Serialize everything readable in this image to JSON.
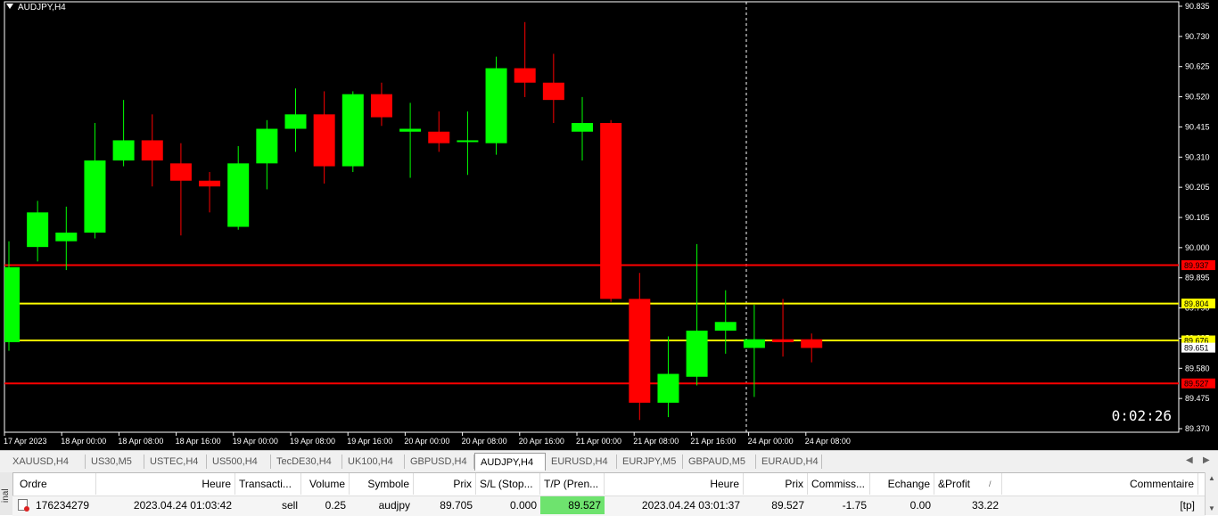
{
  "chart": {
    "title": "AUDJPY,H4",
    "timer": "0:02:26",
    "colors": {
      "bull": "#00ff00",
      "bear": "#ff0000",
      "background": "#000000",
      "grid_text": "#ffffff",
      "sl_line": "#ff0000",
      "tp_line": "#ffff00"
    }
  },
  "chart_data": {
    "type": "candlestick",
    "symbol": "AUDJPY",
    "timeframe": "H4",
    "ylim": [
      89.37,
      90.835
    ],
    "y_ticks": [
      "90.835",
      "90.730",
      "90.625",
      "90.520",
      "90.415",
      "90.310",
      "90.205",
      "90.105",
      "90.000",
      "89.895",
      "89.790",
      "89.685",
      "89.580",
      "89.475",
      "89.370"
    ],
    "x_ticks": [
      "17 Apr 2023",
      "18 Apr 00:00",
      "18 Apr 08:00",
      "18 Apr 16:00",
      "19 Apr 00:00",
      "19 Apr 08:00",
      "19 Apr 16:00",
      "20 Apr 00:00",
      "20 Apr 08:00",
      "20 Apr 16:00",
      "21 Apr 00:00",
      "21 Apr 08:00",
      "21 Apr 16:00",
      "24 Apr 00:00",
      "24 Apr 08:00"
    ],
    "candles": [
      {
        "o": 89.67,
        "h": 90.02,
        "l": 89.64,
        "c": 89.93
      },
      {
        "o": 90.0,
        "h": 90.16,
        "l": 89.95,
        "c": 90.12
      },
      {
        "o": 90.02,
        "h": 90.14,
        "l": 89.92,
        "c": 90.05
      },
      {
        "o": 90.05,
        "h": 90.43,
        "l": 90.03,
        "c": 90.3
      },
      {
        "o": 90.3,
        "h": 90.51,
        "l": 90.28,
        "c": 90.37
      },
      {
        "o": 90.37,
        "h": 90.46,
        "l": 90.21,
        "c": 90.3
      },
      {
        "o": 90.29,
        "h": 90.36,
        "l": 90.04,
        "c": 90.23
      },
      {
        "o": 90.23,
        "h": 90.26,
        "l": 90.12,
        "c": 90.21
      },
      {
        "o": 90.07,
        "h": 90.35,
        "l": 90.06,
        "c": 90.29
      },
      {
        "o": 90.29,
        "h": 90.44,
        "l": 90.2,
        "c": 90.41
      },
      {
        "o": 90.41,
        "h": 90.55,
        "l": 90.33,
        "c": 90.46
      },
      {
        "o": 90.46,
        "h": 90.54,
        "l": 90.22,
        "c": 90.28
      },
      {
        "o": 90.28,
        "h": 90.54,
        "l": 90.26,
        "c": 90.53
      },
      {
        "o": 90.53,
        "h": 90.57,
        "l": 90.42,
        "c": 90.45
      },
      {
        "o": 90.4,
        "h": 90.5,
        "l": 90.24,
        "c": 90.41
      },
      {
        "o": 90.4,
        "h": 90.47,
        "l": 90.33,
        "c": 90.36
      },
      {
        "o": 90.37,
        "h": 90.47,
        "l": 90.25,
        "c": 90.37
      },
      {
        "o": 90.36,
        "h": 90.66,
        "l": 90.32,
        "c": 90.62
      },
      {
        "o": 90.62,
        "h": 90.78,
        "l": 90.52,
        "c": 90.57
      },
      {
        "o": 90.57,
        "h": 90.67,
        "l": 90.43,
        "c": 90.51
      },
      {
        "o": 90.4,
        "h": 90.52,
        "l": 90.3,
        "c": 90.43
      },
      {
        "o": 90.43,
        "h": 90.44,
        "l": 89.81,
        "c": 89.82
      },
      {
        "o": 89.82,
        "h": 89.91,
        "l": 89.4,
        "c": 89.46
      },
      {
        "o": 89.46,
        "h": 89.69,
        "l": 89.41,
        "c": 89.56
      },
      {
        "o": 89.55,
        "h": 90.01,
        "l": 89.52,
        "c": 89.71
      },
      {
        "o": 89.71,
        "h": 89.85,
        "l": 89.63,
        "c": 89.74
      },
      {
        "o": 89.65,
        "h": 89.8,
        "l": 89.48,
        "c": 89.68
      },
      {
        "o": 89.68,
        "h": 89.82,
        "l": 89.62,
        "c": 89.67
      },
      {
        "o": 89.68,
        "h": 89.7,
        "l": 89.6,
        "c": 89.65
      }
    ],
    "levels": [
      {
        "price": 89.937,
        "label": "89.937",
        "role": "sl"
      },
      {
        "price": 89.804,
        "label": "89.804",
        "role": "tp"
      },
      {
        "price": 89.676,
        "label": "89.676",
        "role": "tp"
      },
      {
        "price": 89.527,
        "label": "89.527",
        "role": "sl"
      }
    ],
    "bid": {
      "price": 89.651,
      "label": "89.651"
    }
  },
  "tabs": {
    "items": [
      "XAUUSD,H4",
      "US30,M5",
      "USTEC,H4",
      "US500,H4",
      "TecDE30,H4",
      "UK100,H4",
      "GBPUSD,H4",
      "AUDJPY,H4",
      "EURUSD,H4",
      "EURJPY,M5",
      "GBPAUD,M5",
      "EURAUD,H4"
    ],
    "active": "AUDJPY,H4"
  },
  "trade": {
    "side_label": "inal",
    "headers": [
      "Ordre",
      "Heure",
      "Transacti...",
      "Volume",
      "Symbole",
      "Prix",
      "S/L (Stop...",
      "T/P (Pren...",
      "Heure",
      "Prix",
      "Commiss...",
      "Echange",
      "&Profit",
      "Commentaire"
    ],
    "sort_indicator": "/",
    "row": [
      "176234279",
      "2023.04.24 01:03:42",
      "sell",
      "0.25",
      "audjpy",
      "89.705",
      "0.000",
      "89.527",
      "2023.04.24 03:01:37",
      "89.527",
      "-1.75",
      "0.00",
      "33.22",
      "[tp]"
    ]
  }
}
